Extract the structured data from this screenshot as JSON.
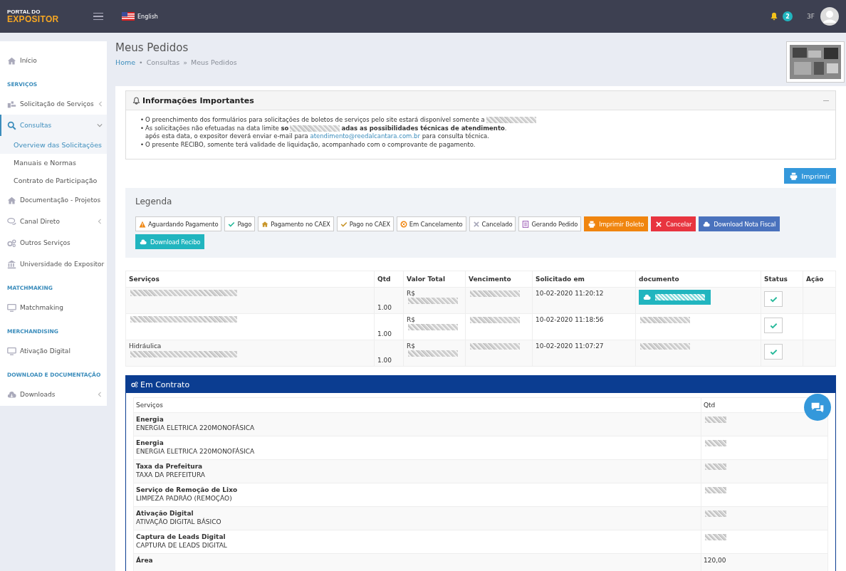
{
  "header": {
    "logo_top": "PORTAL DO",
    "logo_bottom": "EXPOSITOR",
    "language": "English",
    "notifications": "2",
    "user": "3F"
  },
  "sidebar": {
    "items": [
      {
        "kind": "link",
        "label": "Início",
        "selected": false
      },
      {
        "kind": "section",
        "label": "SERVIÇOS"
      },
      {
        "kind": "link",
        "label": "Solicitação de Serviços",
        "selected": false,
        "expanded": false
      },
      {
        "kind": "link",
        "label": "Consultas",
        "selected": true,
        "expanded": true,
        "children": [
          {
            "label": "Overview das Solicitações",
            "selected": true
          },
          {
            "label": "Manuais e Normas",
            "selected": false
          },
          {
            "label": "Contrato de Participação",
            "selected": false
          }
        ]
      },
      {
        "kind": "link",
        "label": "Documentação - Projetos",
        "selected": false
      },
      {
        "kind": "link",
        "label": "Canal Direto",
        "selected": false,
        "expanded": false
      },
      {
        "kind": "link",
        "label": "Outros Serviços",
        "selected": false
      },
      {
        "kind": "link",
        "label": "Universidade do Expositor",
        "selected": false
      },
      {
        "kind": "section",
        "label": "MATCHMAKING"
      },
      {
        "kind": "link",
        "label": "Matchmaking",
        "selected": false
      },
      {
        "kind": "section",
        "label": "MERCHANDISING"
      },
      {
        "kind": "link",
        "label": "Ativação Digital",
        "selected": false
      },
      {
        "kind": "section",
        "label": "DOWNLOAD E DOCUMENTAÇÃO"
      },
      {
        "kind": "link",
        "label": "Downloads",
        "selected": false,
        "expanded": false
      }
    ]
  },
  "page": {
    "title": "Meus Pedidos",
    "breadcrumb": [
      {
        "label": "Home"
      },
      {
        "separator": "•",
        "label": "Consultas"
      },
      {
        "separator": "»",
        "label": "Meus Pedidos"
      }
    ]
  },
  "info": {
    "title": "Informações Importantes",
    "bullets": [
      {
        "bullet": "•",
        "lines": [
          {
            "text": "O preenchimento dos formulários para solicitações de boletos de serviços pelo site estará disponível somente a",
            "redacted_after": true
          }
        ]
      },
      {
        "bullet": "•",
        "lines": [
          {
            "text": "As solicitações não efetuadas na data limite **so**",
            "redacted_after": true,
            "tail": "**adas as possibilidades técnicas de atendimento**."
          },
          {
            "text": "após esta data, o expositor deverá enviar e-mail para ",
            "link": "atendimento@reedalcantara.com.br",
            "tail": " para consulta técnica."
          }
        ]
      },
      {
        "bullet": "•",
        "lines": [
          {
            "text": "O presente RECIBO, somente terá validade de liquidação, acompanhado com o comprovante de pagamento."
          }
        ]
      }
    ]
  },
  "print_button": "Imprimir",
  "legend": {
    "title": "Legenda",
    "items": [
      {
        "kind": "outline",
        "label": "Aguardando Pagamento"
      },
      {
        "kind": "outline",
        "label": "Pago"
      },
      {
        "kind": "outline",
        "label": "Pagamento no CAEX"
      },
      {
        "kind": "outline",
        "label": "Pago no CAEX"
      },
      {
        "kind": "outline",
        "label": "Em Cancelamento"
      },
      {
        "kind": "outline",
        "label": "Cancelado"
      },
      {
        "kind": "outline",
        "label": "Gerando Pedido"
      },
      {
        "kind": "solid",
        "color": "#f0850f",
        "label": "Imprimir Boleto"
      },
      {
        "kind": "solid",
        "color": "#e8343f",
        "label": "Cancelar"
      },
      {
        "kind": "solid",
        "color": "#4a72bd",
        "label": "Download Nota Fiscal"
      },
      {
        "kind": "solid",
        "color": "#21b5bf",
        "label": "Download Recibo"
      }
    ]
  },
  "orders": {
    "columns": [
      "Serviços",
      "Qtd",
      "Valor Total",
      "Vencimento",
      "Solicitado em",
      "documento",
      "Status",
      "Ação"
    ],
    "rows": [
      {
        "service_redacted": true,
        "qtd": "1.00",
        "valor": "R$",
        "valor_redacted": true,
        "vencimento_redacted": true,
        "solicitado": "10-02-2020 11:20:12",
        "document_button": true,
        "document_redacted": true,
        "status_checked": true
      },
      {
        "service_redacted": true,
        "qtd": "1.00",
        "valor": "R$",
        "valor_redacted": true,
        "vencimento_redacted": true,
        "solicitado": "10-02-2020 11:18:56",
        "document_button": false,
        "document_redacted": true,
        "status_checked": true
      },
      {
        "service": "Hidráulica",
        "service_redacted": true,
        "qtd": "1.00",
        "valor": "R$",
        "valor_redacted": true,
        "vencimento_redacted": true,
        "solicitado": "10-02-2020 11:07:27",
        "document_button": false,
        "document_redacted": true,
        "status_checked": true
      }
    ]
  },
  "contract": {
    "title": "Em Contrato",
    "columns": [
      "Serviços",
      "Qtd"
    ],
    "rows": [
      {
        "name": "Energia",
        "desc": "ENERGIA ELETRICA 220MONOFÁSICA",
        "qtd_redacted": true
      },
      {
        "name": "Energia",
        "desc": "ENERGIA ELETRICA 220MONOFÁSICA",
        "qtd_redacted": true
      },
      {
        "name": "Taxa da Prefeitura",
        "desc": "TAXA DA PREFEITURA",
        "qtd_redacted": true
      },
      {
        "name": "Serviço de Remoção de Lixo",
        "desc": "LIMPEZA PADRÃO (REMOÇÃO)",
        "qtd_redacted": true
      },
      {
        "name": "Ativação Digital",
        "desc": "ATIVAÇÃO DIGITAL BÁSICO",
        "qtd_redacted": true
      },
      {
        "name": "Captura de Leads Digital",
        "desc": "CAPTURA DE LEADS DIGITAL",
        "qtd_redacted": true
      },
      {
        "name": "Área",
        "qtd": "120,00"
      }
    ]
  }
}
